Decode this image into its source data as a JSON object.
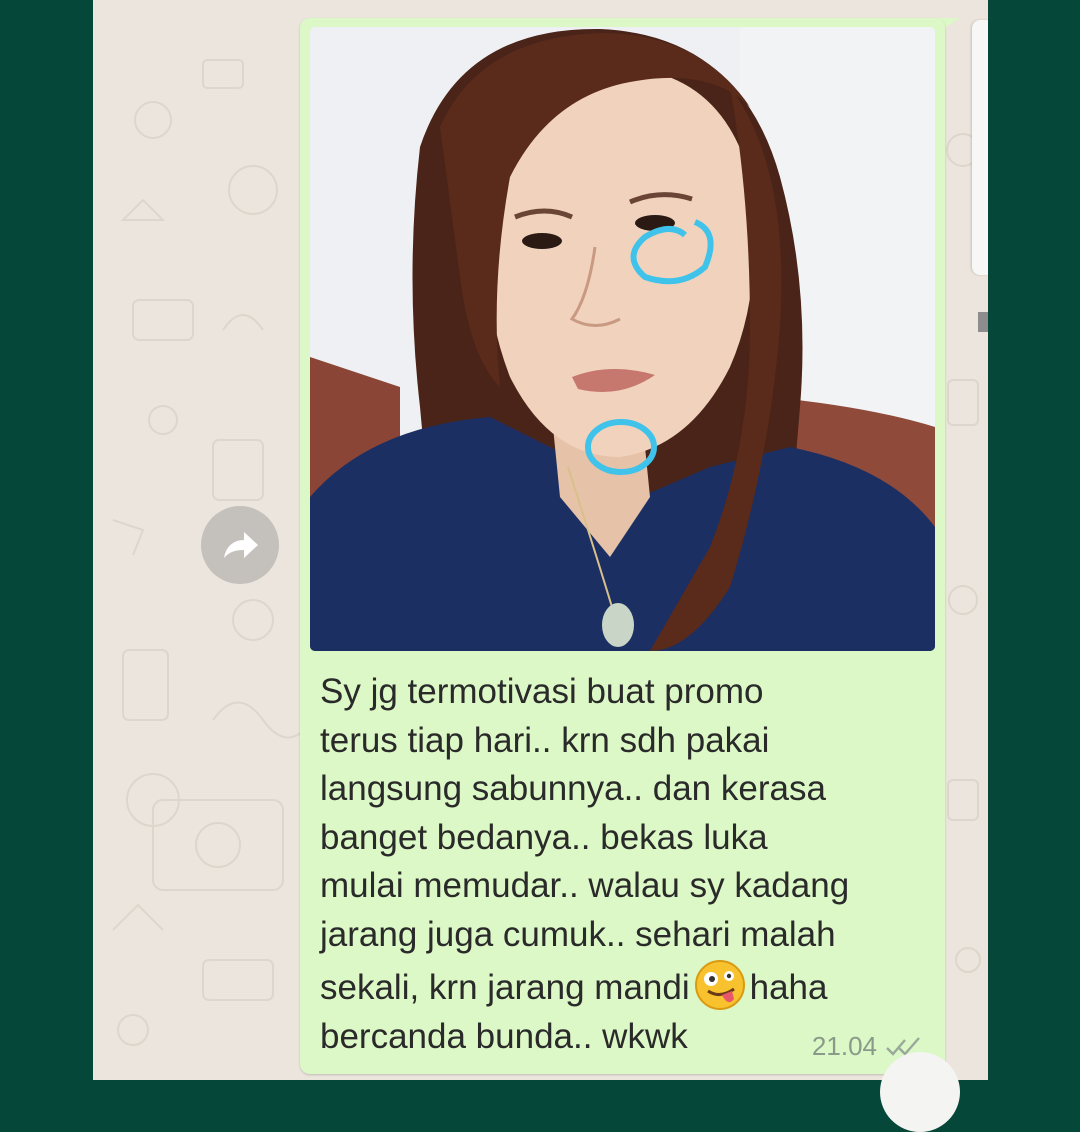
{
  "message": {
    "lines": [
      "Sy jg termotivasi buat promo",
      "terus tiap hari.. krn sdh pakai",
      "langsung sabunnya.. dan kerasa",
      "banget bedanya.. bekas luka",
      "mulai memudar.. walau sy kadang",
      "jarang juga cumuk.. sehari malah"
    ],
    "line_emoji_before": "sekali, krn jarang mandi",
    "emoji_icon": "zany-face-emoji",
    "line_emoji_after": "haha",
    "last_line": "bercanda bunda.. wkwk",
    "time": "21.04",
    "status_icon": "double-check-icon"
  },
  "photo": {
    "subject": "selfie-photo",
    "annotations_color": "#3fc3ea"
  },
  "colors": {
    "bubble": "#dcf8c6",
    "chat_background": "#ebe5dd",
    "frame": "#05483a"
  }
}
